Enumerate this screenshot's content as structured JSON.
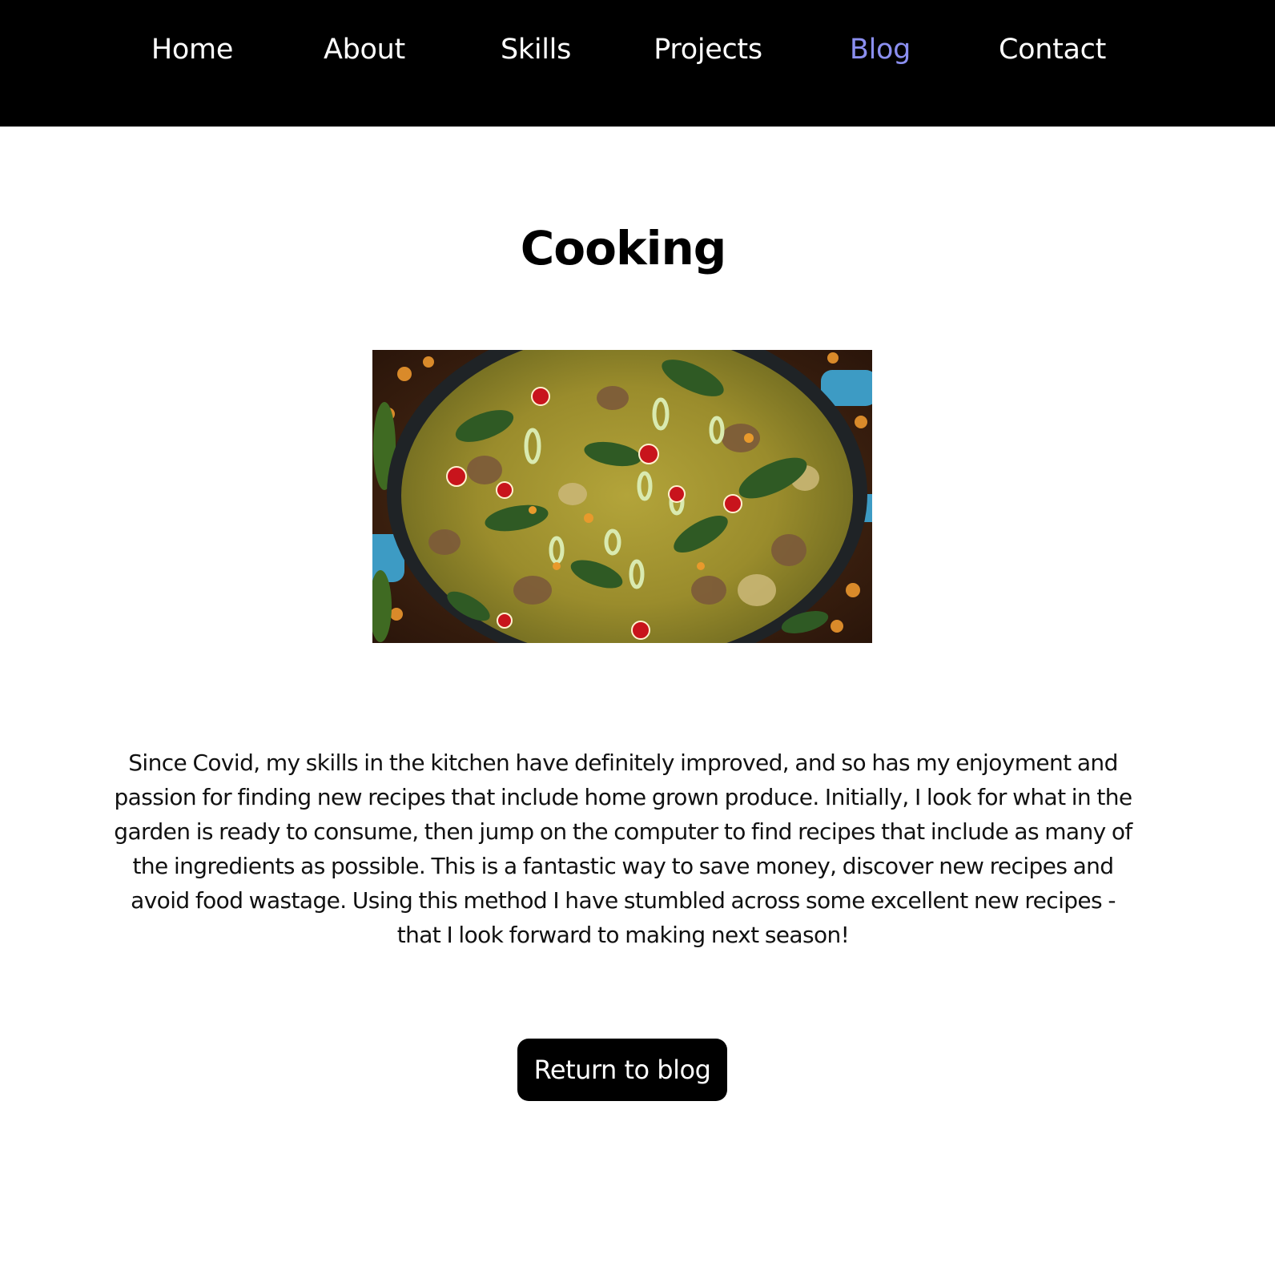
{
  "nav": {
    "items": [
      {
        "label": "Home",
        "active": false
      },
      {
        "label": "About",
        "active": false
      },
      {
        "label": "Skills",
        "active": false
      },
      {
        "label": "Projects",
        "active": false
      },
      {
        "label": "Blog",
        "active": true
      },
      {
        "label": "Contact",
        "active": false
      }
    ]
  },
  "post": {
    "title": "Cooking",
    "body": "Since Covid, my skills in the kitchen have definitely improved, and so has my enjoyment and passion for finding new recipes that include home grown produce. Initially, I look for what in the garden is ready to consume, then jump on the computer to find recipes that include as many of the ingredients as possible. This is a fantastic way to save money, discover new recipes and avoid food wastage. Using this method I have stumbled across some excellent new recipes - that I look forward to making next season!",
    "return_label": "Return to blog"
  },
  "colors": {
    "nav_background": "#000000",
    "nav_text": "#ffffff",
    "nav_active": "#8b8ff0",
    "button_background": "#000000",
    "button_text": "#ffffff"
  }
}
